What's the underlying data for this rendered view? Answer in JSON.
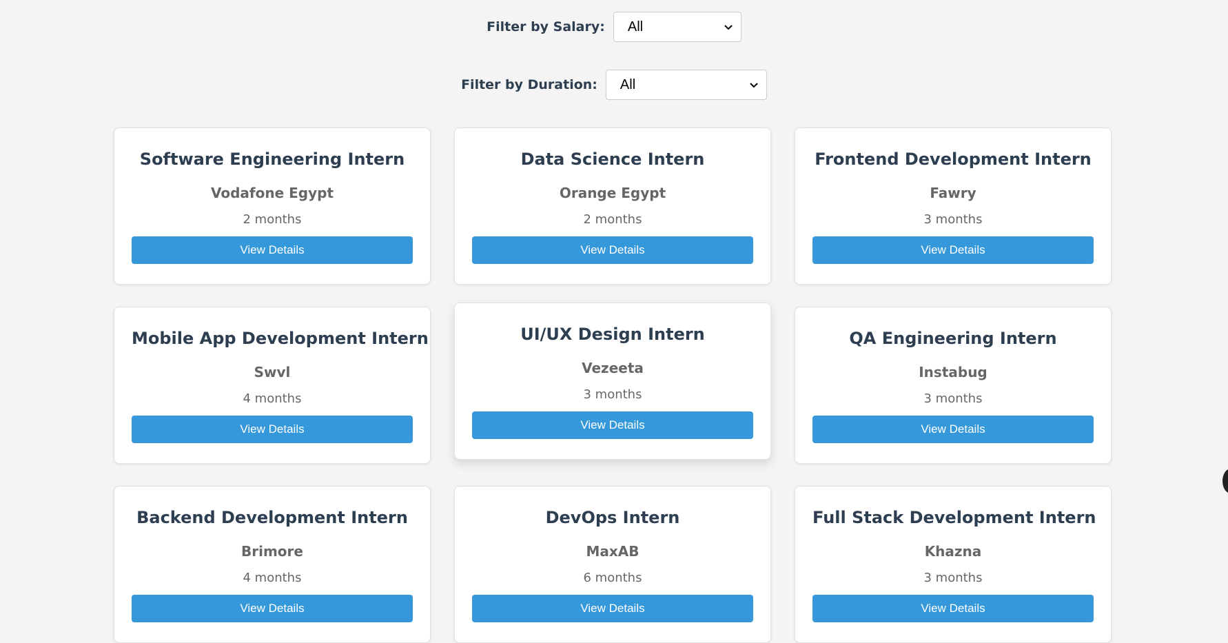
{
  "filters": {
    "salary": {
      "label": "Filter by Salary:",
      "value": "All"
    },
    "duration": {
      "label": "Filter by Duration:",
      "value": "All"
    }
  },
  "button_label": "View Details",
  "colors": {
    "accent": "#3498db",
    "title": "#2c3e50",
    "muted": "#666666",
    "background": "#f4f4f4"
  },
  "internships": [
    {
      "title": "Software Engineering Intern",
      "company": "Vodafone Egypt",
      "duration": "2 months"
    },
    {
      "title": "Data Science Intern",
      "company": "Orange Egypt",
      "duration": "2 months"
    },
    {
      "title": "Frontend Development Intern",
      "company": "Fawry",
      "duration": "3 months"
    },
    {
      "title": "Mobile App Development Intern",
      "company": "Swvl",
      "duration": "4 months"
    },
    {
      "title": "UI/UX Design Intern",
      "company": "Vezeeta",
      "duration": "3 months"
    },
    {
      "title": "QA Engineering Intern",
      "company": "Instabug",
      "duration": "3 months"
    },
    {
      "title": "Backend Development Intern",
      "company": "Brimore",
      "duration": "4 months"
    },
    {
      "title": "DevOps Intern",
      "company": "MaxAB",
      "duration": "6 months"
    },
    {
      "title": "Full Stack Development Intern",
      "company": "Khazna",
      "duration": "3 months"
    }
  ]
}
